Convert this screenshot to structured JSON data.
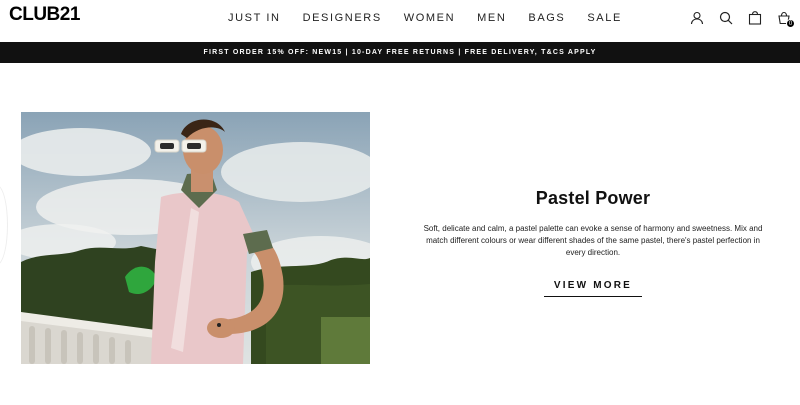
{
  "brand": {
    "logo_text": "CLUB21"
  },
  "nav": {
    "items": [
      {
        "label": "JUST IN"
      },
      {
        "label": "DESIGNERS"
      },
      {
        "label": "WOMEN"
      },
      {
        "label": "MEN"
      },
      {
        "label": "BAGS"
      },
      {
        "label": "SALE"
      }
    ]
  },
  "header_icons": [
    "account-icon",
    "search-icon",
    "bag-icon",
    "cart-icon"
  ],
  "cart": {
    "count": "0"
  },
  "promo": {
    "text": "FIRST ORDER 15% OFF: NEW15 | 10-DAY FREE RETURNS | FREE DELIVERY, T&CS APPLY"
  },
  "feature": {
    "title": "Pastel Power",
    "body": "Soft, delicate and calm, a pastel palette can evoke a sense of harmony and sweetness. Mix and match different colours or wear different shades of the same pastel, there's pastel perfection in every direction.",
    "cta": "VIEW MORE"
  },
  "colors": {
    "promo_bg": "#111111",
    "text": "#111111",
    "shirt_pink": "#e9c7c9"
  }
}
